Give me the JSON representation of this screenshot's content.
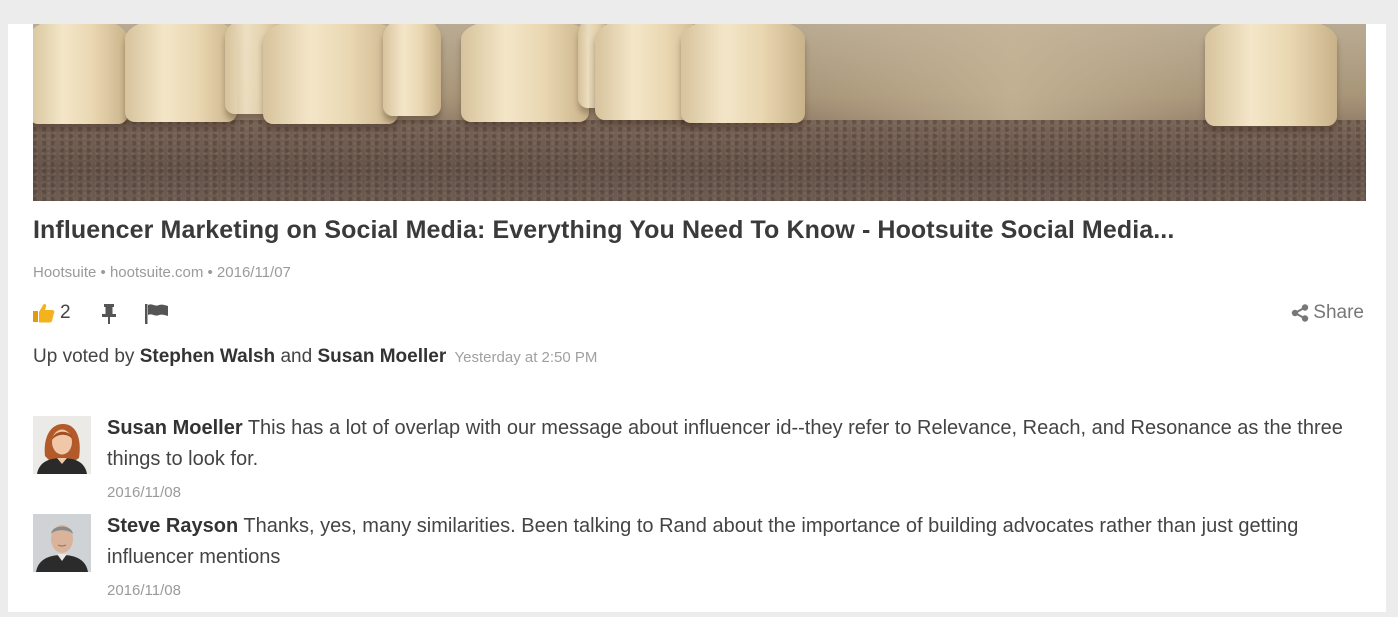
{
  "article": {
    "title": "Influencer Marketing on Social Media: Everything You Need To Know - Hootsuite Social Media...",
    "meta": "Hootsuite • hootsuite.com • 2016/11/07",
    "like_count": "2",
    "share_label": "Share"
  },
  "icons": {
    "like": "thumbs-up-icon",
    "pin": "pin-icon",
    "flag": "flag-icon",
    "share": "share-icon"
  },
  "upvotes": {
    "prefix": "Up voted by",
    "user1": "Stephen Walsh",
    "conjunction": "and",
    "user2": "Susan Moeller",
    "time": "Yesterday at 2:50 PM"
  },
  "comments": [
    {
      "author": "Susan Moeller",
      "text": "This has a lot of overlap with our message about influencer id--they refer to Relevance, Reach, and Resonance as the three things to look for.",
      "date": "2016/11/08"
    },
    {
      "author": "Steve Rayson",
      "text": "Thanks, yes, many similarities. Been talking to Rand about the importance of building advocates rather than just getting influencer mentions",
      "date": "2016/11/08"
    }
  ],
  "colors": {
    "like_icon": "#f5b21f",
    "background": "#ececec",
    "card": "#ffffff"
  }
}
